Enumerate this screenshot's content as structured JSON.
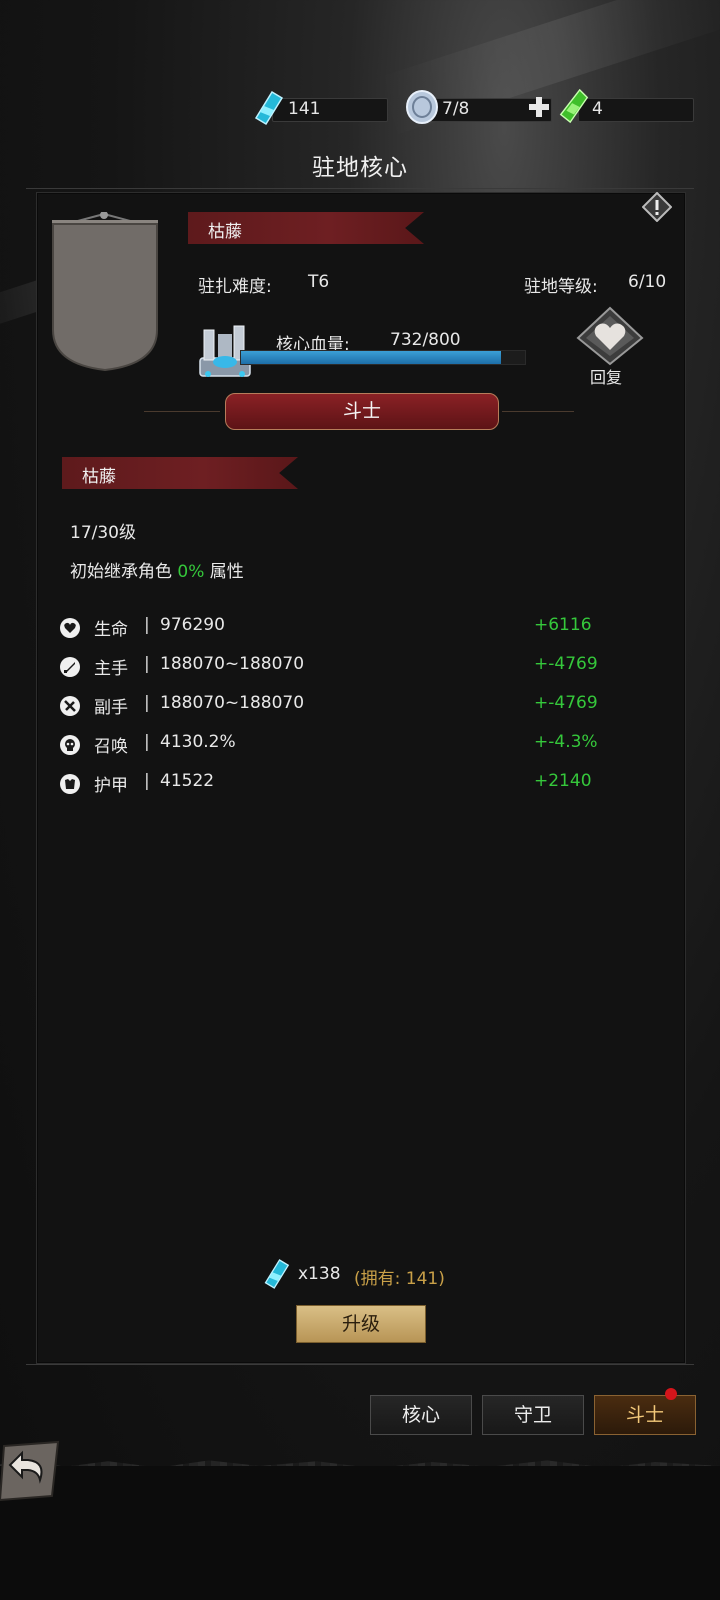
{
  "colors": {
    "accent_red": "#6e1f22",
    "hp_blue": "#3b9fd6",
    "delta_green": "#35c83b",
    "gold": "#d9bf86"
  },
  "currencies": [
    {
      "icon": "blue-crystal-icon",
      "value": "141"
    },
    {
      "icon": "silver-coin-icon",
      "value": "7/8"
    },
    {
      "icon": "green-crystal-icon",
      "value": "4"
    }
  ],
  "header": {
    "title": "驻地核心"
  },
  "camp": {
    "name": "枯藤",
    "difficulty_label": "驻扎难度:",
    "difficulty_value": "T6",
    "level_label": "驻地等级:",
    "level_value": "6/10",
    "hp_label": "核心血量:",
    "hp_value": "732/800",
    "hp_fraction": 0.915,
    "restore_label": "回复"
  },
  "class_name": "斗士",
  "fighter": {
    "name": "枯藤",
    "level_text": "17/30级",
    "inherit_prefix": "初始继承角色",
    "inherit_pct": "0%",
    "inherit_suffix": "属性"
  },
  "stats": [
    {
      "icon": "heart-icon",
      "label": "生命",
      "value": "976290",
      "delta": "+6116"
    },
    {
      "icon": "main-hand-sword-icon",
      "label": "主手",
      "value": "188070~188070",
      "delta": "+-4769"
    },
    {
      "icon": "off-hand-shield-icon",
      "label": "副手",
      "value": "188070~188070",
      "delta": "+-4769"
    },
    {
      "icon": "summon-skull-icon",
      "label": "召唤",
      "value": "4130.2%",
      "delta": "+-4.3%"
    },
    {
      "icon": "armor-chest-icon",
      "label": "护甲",
      "value": "41522",
      "delta": "+2140"
    }
  ],
  "upgrade": {
    "cost": "x138",
    "owned": "(拥有: 141)",
    "button_label": "升级"
  },
  "tabs": [
    {
      "label": "核心",
      "active": false
    },
    {
      "label": "守卫",
      "active": false
    },
    {
      "label": "斗士",
      "active": true
    }
  ]
}
